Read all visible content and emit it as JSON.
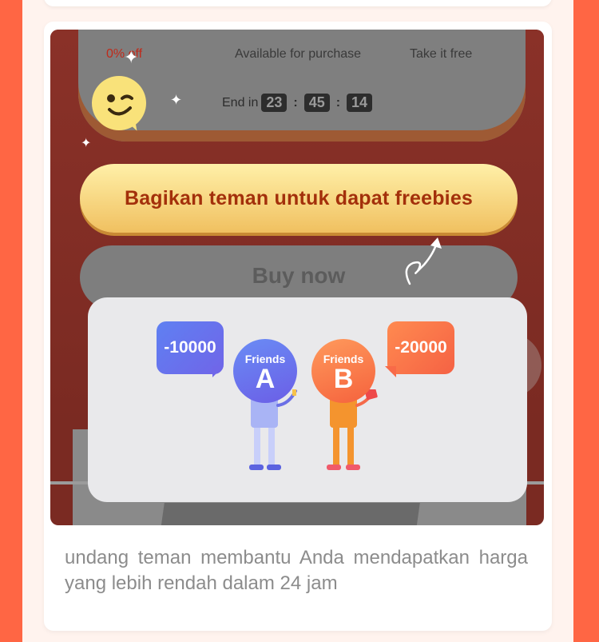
{
  "stats": {
    "discount": "0% off",
    "availability": "Available for purchase",
    "free": "Take it free"
  },
  "countdown": {
    "label": "End in",
    "hours": "23",
    "minutes": "45",
    "seconds": "14"
  },
  "share_button_label": "Bagikan teman untuk dapat freebies",
  "buy_button_label": "Buy now",
  "illustration": {
    "friend_a_word": "Friends",
    "friend_a_letter": "A",
    "friend_b_word": "Friends",
    "friend_b_letter": "B",
    "bubble_a_value": "-10000",
    "bubble_b_value": "-20000"
  },
  "caption": "undang teman membantu Anda mendapatkan harga yang lebih rendah dalam 24 jam",
  "colors": {
    "side_stripe": "#ff6644",
    "share_text": "#a3300b",
    "friend_a": "#6b7cf0",
    "friend_b": "#f66a46"
  }
}
